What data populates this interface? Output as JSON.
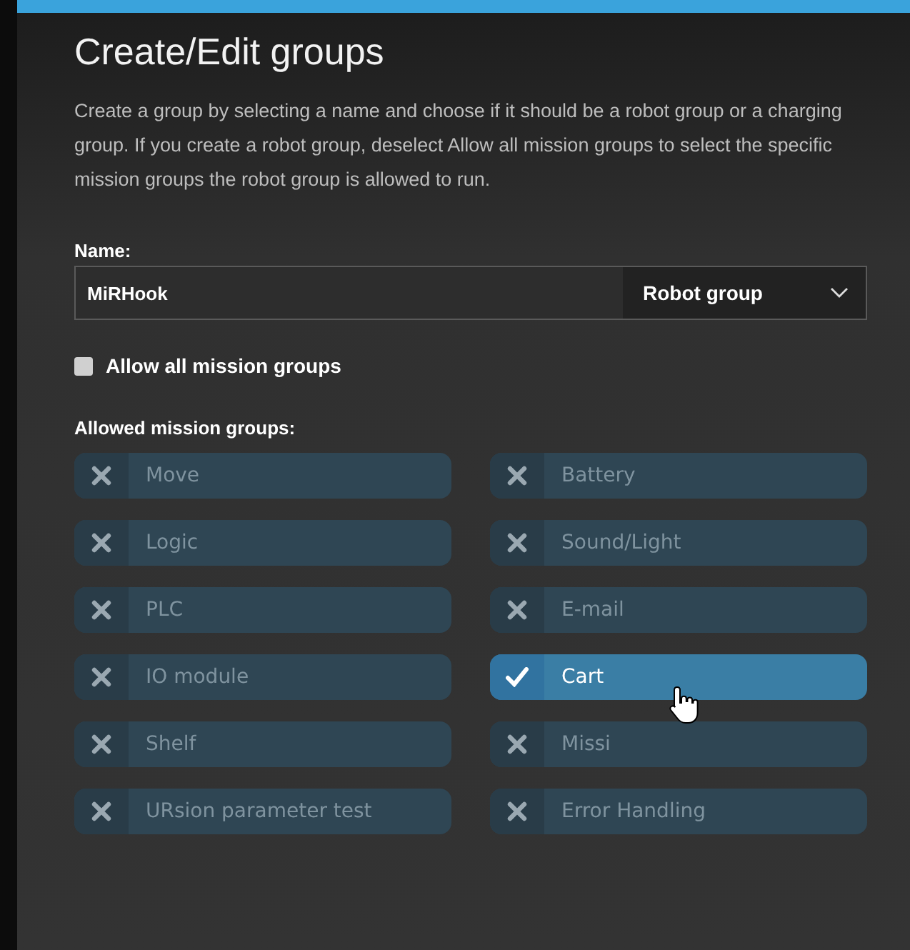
{
  "title": "Create/Edit groups",
  "description": "Create a group by selecting a name and choose if it should be a robot group or a charging group. If you create a robot group, deselect Allow all mission groups to select the specific mission groups the robot group is allowed to run.",
  "name_field": {
    "label": "Name:",
    "value": "MiRHook"
  },
  "group_type": {
    "value": "Robot group"
  },
  "allow_all": {
    "label": "Allow all mission groups",
    "checked": false
  },
  "allowed_label": "Allowed mission groups:",
  "mission_groups": [
    {
      "label": "Move",
      "selected": false
    },
    {
      "label": "Battery",
      "selected": false
    },
    {
      "label": "Logic",
      "selected": false
    },
    {
      "label": "Sound/Light",
      "selected": false
    },
    {
      "label": "PLC",
      "selected": false
    },
    {
      "label": "E-mail",
      "selected": false
    },
    {
      "label": "IO module",
      "selected": false
    },
    {
      "label": "Cart",
      "selected": true
    },
    {
      "label": "Shelf",
      "selected": false
    },
    {
      "label": "Missi",
      "selected": false
    },
    {
      "label": "URsion parameter test",
      "selected": false
    },
    {
      "label": "Error Handling",
      "selected": false
    }
  ]
}
